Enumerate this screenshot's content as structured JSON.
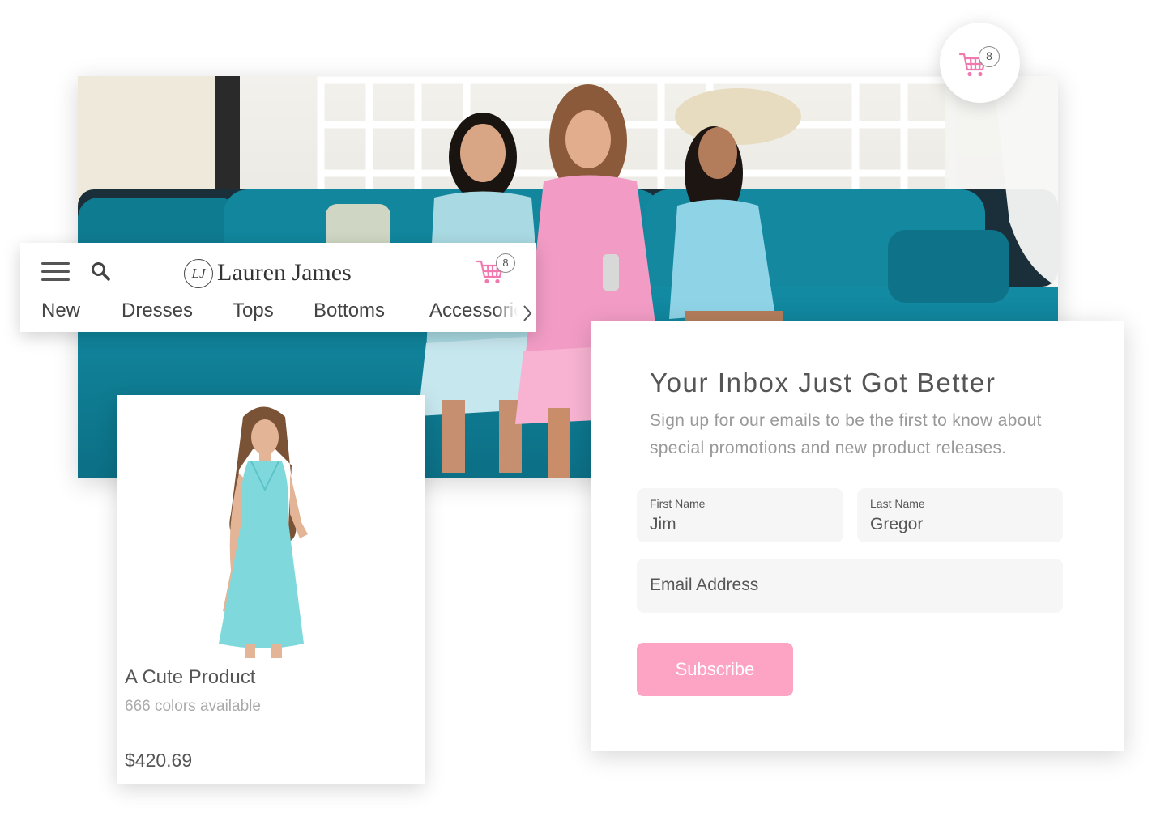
{
  "brand": {
    "monogram": "LJ",
    "name": "Lauren James"
  },
  "cart": {
    "count": "8",
    "floating_count": "8"
  },
  "nav": {
    "tabs": [
      "New",
      "Dresses",
      "Tops",
      "Bottoms",
      "Accessories"
    ]
  },
  "product": {
    "name": "A Cute Product",
    "colors": "666 colors available",
    "price": "$420.69"
  },
  "signup": {
    "title": "Your Inbox Just Got Better",
    "description": "Sign up for our emails to be the first to know about special promotions and new product releases.",
    "first_name": {
      "label": "First Name",
      "value": "Jim"
    },
    "last_name": {
      "label": "Last Name",
      "value": "Gregor"
    },
    "email": {
      "placeholder": "Email Address"
    },
    "subscribe_label": "Subscribe"
  },
  "colors": {
    "accent_pink": "#fda4c4",
    "cart_pink": "#f07ab0",
    "sofa_teal": "#12839a"
  },
  "icons": [
    "cart-icon",
    "hamburger-menu-icon",
    "search-icon",
    "chevron-right-icon"
  ]
}
